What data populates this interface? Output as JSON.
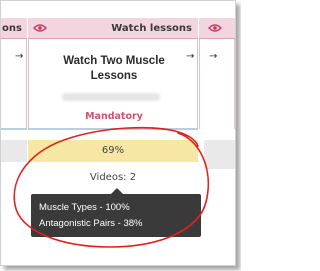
{
  "left_column": {
    "header_text": "ons",
    "arrow": "→"
  },
  "main_column": {
    "header_title": "Watch lessons",
    "eye_icon": "eye-icon",
    "arrow": "→",
    "lesson_title_line1": "Watch Two Muscle",
    "lesson_title_line2": "Lessons",
    "status": "Mandatory",
    "progress": "69%",
    "videos": "Videos: 2"
  },
  "right_column": {
    "eye_icon": "eye-icon",
    "arrow": "→"
  },
  "tooltip": {
    "line1": "Muscle Types  - 100%",
    "line2": "Antagonistic Pairs  - 38%"
  },
  "colors": {
    "header_bg": "#f3d5df",
    "mandatory": "#d0536f",
    "progress_bg": "#f7e7a4",
    "annotation": "#e02020"
  }
}
